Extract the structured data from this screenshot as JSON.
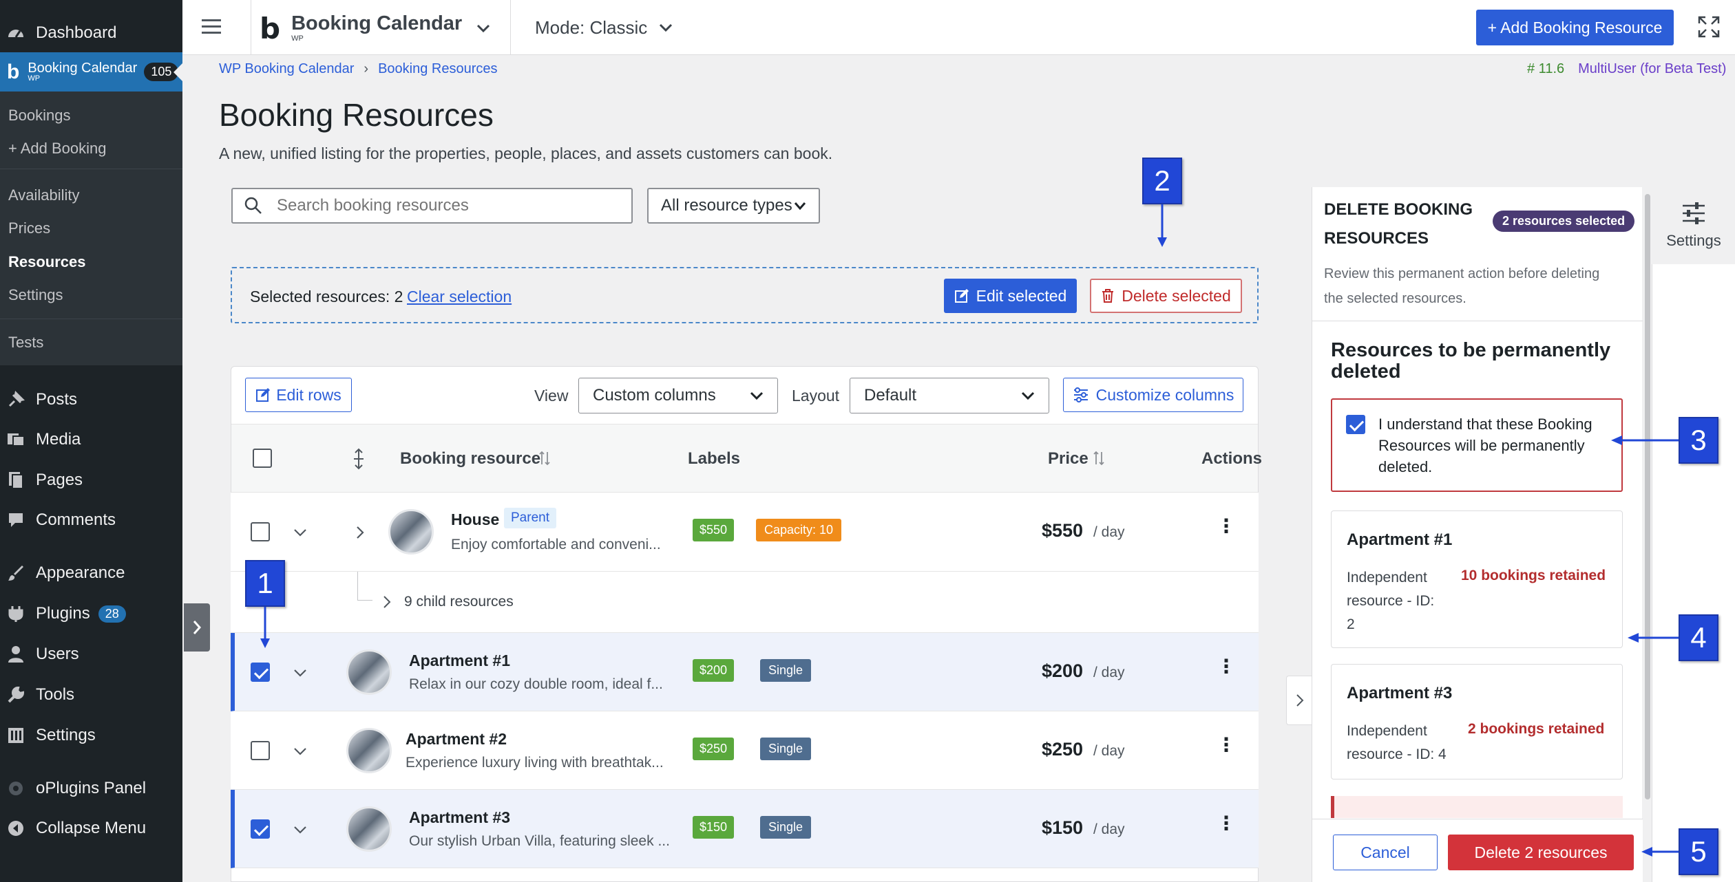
{
  "wp_menu": {
    "dashboard": "Dashboard",
    "booking_calendar": "Booking Calendar",
    "booking_calendar_wp": "WP",
    "booking_count": "105",
    "sub": {
      "bookings": "Bookings",
      "add_booking": "+ Add Booking",
      "availability": "Availability",
      "prices": "Prices",
      "resources": "Resources",
      "settings": "Settings",
      "tests": "Tests"
    },
    "posts": "Posts",
    "media": "Media",
    "pages": "Pages",
    "comments": "Comments",
    "appearance": "Appearance",
    "plugins": "Plugins",
    "plugins_count": "28",
    "users": "Users",
    "tools": "Tools",
    "settings": "Settings",
    "oplugins": "oPlugins Panel",
    "collapse": "Collapse Menu"
  },
  "topbar": {
    "app_name": "Booking Calendar",
    "app_sub": "WP",
    "mode": "Mode: Classic",
    "add_button": "+ Add Booking Resource"
  },
  "breadcrumb": {
    "root": "WP Booking Calendar",
    "sep": "›",
    "current": "Booking Resources"
  },
  "version": {
    "number": "# 11.6",
    "edition": "MultiUser (for Beta Test)"
  },
  "page": {
    "title": "Booking Resources",
    "subtitle": "A new, unified listing for the properties, people, places, and assets customers can book."
  },
  "filters": {
    "search_placeholder": "Search booking resources",
    "type_select": "All resource types"
  },
  "selection": {
    "label": "Selected resources: 2",
    "clear": "Clear selection",
    "edit": "Edit selected",
    "delete": "Delete selected"
  },
  "toolbar": {
    "edit_rows": "Edit rows",
    "view_label": "View",
    "view_value": "Custom columns",
    "layout_label": "Layout",
    "layout_value": "Default",
    "customize": "Customize columns"
  },
  "table": {
    "col_resource": "Booking resource",
    "col_labels": "Labels",
    "col_price": "Price",
    "col_actions": "Actions",
    "rows": [
      {
        "title": "House",
        "badge": "Parent",
        "desc": "Enjoy comfortable and conveni...",
        "price_tag": "$550",
        "extra_tag": "Capacity: 10",
        "price": "$550",
        "per": "/ day"
      },
      {
        "title": "Apartment #1",
        "desc": "Relax in our cozy double room, ideal f...",
        "price_tag": "$200",
        "extra_tag": "Single",
        "price": "$200",
        "per": "/ day"
      },
      {
        "title": "Apartment #2",
        "desc": "Experience luxury living with breathtak...",
        "price_tag": "$250",
        "extra_tag": "Single",
        "price": "$250",
        "per": "/ day"
      },
      {
        "title": "Apartment #3",
        "desc": "Our stylish Urban Villa, featuring sleek ...",
        "price_tag": "$150",
        "extra_tag": "Single",
        "price": "$150",
        "per": "/ day"
      }
    ],
    "child_resources": "9 child resources"
  },
  "panel": {
    "title_line1": "DELETE BOOKING",
    "title_line2": "RESOURCES",
    "selected_badge": "2 resources selected",
    "desc_line1": "Review this permanent action before deleting",
    "desc_line2": "the selected resources.",
    "section_title_line1": "Resources to be permanently",
    "section_title_line2": "deleted",
    "confirm_line1": "I understand that these Booking",
    "confirm_line2": "Resources will be permanently",
    "confirm_line3": "deleted.",
    "items": [
      {
        "name": "Apartment #1",
        "meta_line1": "Independent",
        "meta_line2": "resource - ID:",
        "meta_line3": "2",
        "bookings": "10 bookings retained"
      },
      {
        "name": "Apartment #3",
        "meta_line1": "Independent",
        "meta_line2": "resource - ID: 4",
        "bookings": "2 bookings retained"
      }
    ],
    "cancel": "Cancel",
    "delete": "Delete 2 resources"
  },
  "settings_tab": "Settings",
  "markers": [
    "1",
    "2",
    "3",
    "4",
    "5"
  ]
}
